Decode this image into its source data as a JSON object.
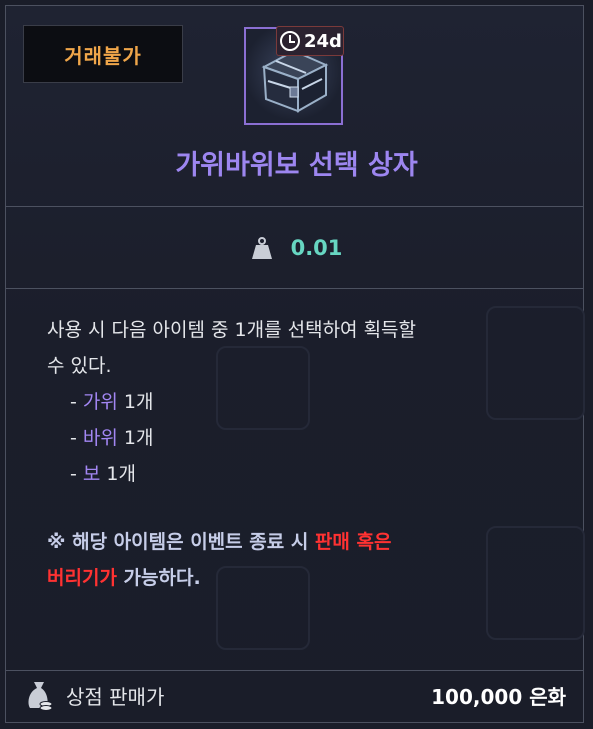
{
  "badge": {
    "trade_label": "거래불가"
  },
  "item": {
    "timer": "24d",
    "icon": "chest-icon",
    "name": "가위바위보 선택 상자"
  },
  "weight": {
    "icon": "weight-icon",
    "value": "0.01"
  },
  "description": {
    "line1": "사용 시 다음 아이템 중 1개를 선택하여 획득할",
    "line2": "수 있다.",
    "options": [
      {
        "dash": "- ",
        "name": "가위",
        "qty": " 1개"
      },
      {
        "dash": "- ",
        "name": "바위",
        "qty": " 1개"
      },
      {
        "dash": "- ",
        "name": "보",
        "qty": " 1개"
      }
    ]
  },
  "notice": {
    "part1": "※ 해당 아이템은 이벤트 종료 시 ",
    "red1": "판매 혹은",
    "red2": "버리기가",
    "part2": " 가능하다."
  },
  "footer": {
    "icon": "money-bag-icon",
    "label": "상점 판매가",
    "price": "100,000 은화"
  },
  "colors": {
    "title": "#9d86f0",
    "weight": "#67d6c2",
    "highlight": "#a286f2",
    "warning": "#ff3232",
    "badge": "#f0a64a"
  }
}
